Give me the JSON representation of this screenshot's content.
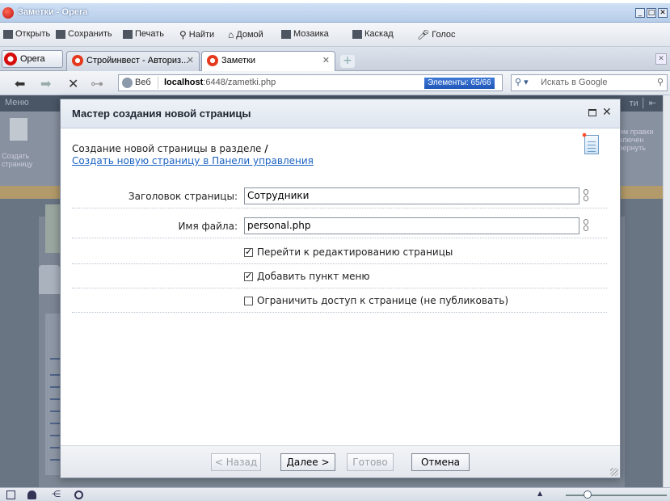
{
  "window": {
    "title": "Заметки - Opera"
  },
  "toolbar": {
    "items": [
      {
        "label": "Открыть",
        "icon": "folder-icon"
      },
      {
        "label": "Сохранить",
        "icon": "save-icon"
      },
      {
        "label": "Печать",
        "icon": "print-icon"
      },
      {
        "label": "Найти",
        "icon": "find-icon"
      },
      {
        "label": "Домой",
        "icon": "home-icon"
      },
      {
        "label": "Мозаика",
        "icon": "tile-icon"
      },
      {
        "label": "Каскад",
        "icon": "cascade-icon"
      },
      {
        "label": "Голос",
        "icon": "voice-icon"
      }
    ]
  },
  "tabs": {
    "menu_label": "Opera",
    "items": [
      {
        "label": "Стройинвест - Авториз..."
      },
      {
        "label": "Заметки"
      }
    ]
  },
  "address": {
    "web_label": "Веб",
    "host": "localhost",
    "url_rest": ":6448/zametki.php",
    "elements_badge": "Элементы:  65/66",
    "search_placeholder": "Искать в Google"
  },
  "page_bg": {
    "menu_label": "Меню",
    "left_text": "Создать страницу",
    "right_text": "им правки\nключен\nвернуть"
  },
  "dialog": {
    "title": "Мастер создания новой страницы",
    "subtitle_prefix": "Создание новой страницы в разделе ",
    "subtitle_section": "/",
    "panel_link": "Создать новую страницу в Панели управления",
    "fields": {
      "page_title_label": "Заголовок страницы:",
      "page_title_value": "Сотрудники",
      "file_name_label": "Имя файла:",
      "file_name_value": "personal.php"
    },
    "checkboxes": [
      {
        "label": "Перейти к редактированию страницы",
        "checked": true
      },
      {
        "label": "Добавить пункт меню",
        "checked": true
      },
      {
        "label": "Ограничить доступ к странице (не публиковать)",
        "checked": false
      }
    ],
    "buttons": {
      "back": "< Назад",
      "next": "Далее >",
      "done": "Готово",
      "cancel": "Отмена"
    }
  }
}
